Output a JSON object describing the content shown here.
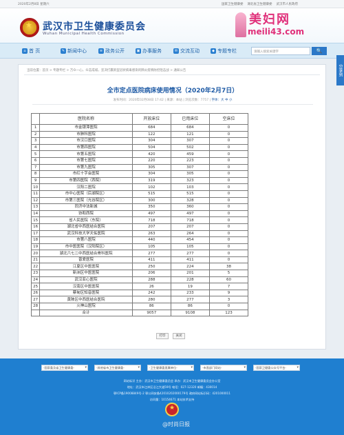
{
  "topbar": {
    "date": "2020年2月8日 星期六",
    "links": [
      "国家卫生健康委",
      "湖北省卫生健康委",
      "武汉市人民政府"
    ]
  },
  "header": {
    "title": "武汉市卫生健康委员会",
    "subtitle": "Wuhan Municipal Health Commission"
  },
  "watermark": {
    "brand": "美妇网",
    "url": "meili43.com"
  },
  "nav": {
    "items": [
      {
        "label": "首 页",
        "icon": "home-icon"
      },
      {
        "label": "新闻中心",
        "icon": "news-icon"
      },
      {
        "label": "政务公开",
        "icon": "document-icon"
      },
      {
        "label": "办事服务",
        "icon": "service-icon"
      },
      {
        "label": "交流互动",
        "icon": "chat-icon"
      },
      {
        "label": "专题专栏",
        "icon": "topic-icon"
      }
    ],
    "search_placeholder": "请输入搜索关键字",
    "search_button": "🔍"
  },
  "side_tab": "分享到",
  "breadcrumb": "当前位置：首页 > 专题专栏 > 万众一心，众志成城，坚决打赢新型冠状病毒感染的肺炎疫情防控阻击战 > 通知公告",
  "article": {
    "title": "全市定点医院病床使用情况（2020年2月7日）",
    "meta_prefix": "发布时间：2020年02月08日 17:42 | 来源：本站 | 浏览次数：",
    "meta_views": "7757",
    "meta_font": "字体：大 中 小"
  },
  "table": {
    "headers": [
      "医院名称",
      "开放床位",
      "已用床位",
      "空床位"
    ],
    "rows": [
      {
        "no": "1",
        "name": "市金银潭医院",
        "open": "684",
        "used": "684",
        "empty": "0"
      },
      {
        "no": "2",
        "name": "市肺科医院",
        "open": "122",
        "used": "121",
        "empty": "0"
      },
      {
        "no": "3",
        "name": "市汉口医院",
        "open": "304",
        "used": "307",
        "empty": "0"
      },
      {
        "no": "4",
        "name": "市第四医院",
        "open": "504",
        "used": "502",
        "empty": "0"
      },
      {
        "no": "5",
        "name": "市第五医院",
        "open": "420",
        "used": "459",
        "empty": "0"
      },
      {
        "no": "6",
        "name": "市第七医院",
        "open": "220",
        "used": "223",
        "empty": "0"
      },
      {
        "no": "7",
        "name": "市第九医院",
        "open": "305",
        "used": "307",
        "empty": "0"
      },
      {
        "no": "8",
        "name": "市红十字会医院",
        "open": "304",
        "used": "305",
        "empty": "0"
      },
      {
        "no": "9",
        "name": "市第四医院（西院）",
        "open": "319",
        "used": "323",
        "empty": "0"
      },
      {
        "no": "10",
        "name": "汉阳二医院",
        "open": "102",
        "used": "103",
        "empty": "0"
      },
      {
        "no": "11",
        "name": "市中心医院（后湖院区）",
        "open": "515",
        "used": "515",
        "empty": "0"
      },
      {
        "no": "12",
        "name": "市第三医院（光谷院区）",
        "open": "300",
        "used": "328",
        "empty": "0"
      },
      {
        "no": "13",
        "name": "同济中法新城",
        "open": "350",
        "used": "360",
        "empty": "0"
      },
      {
        "no": "14",
        "name": "协和西院",
        "open": "497",
        "used": "497",
        "empty": "0"
      },
      {
        "no": "15",
        "name": "省人民医院（东院）",
        "open": "718",
        "used": "718",
        "empty": "0"
      },
      {
        "no": "16",
        "name": "湖北省中西医结合医院",
        "open": "207",
        "used": "207",
        "empty": "0"
      },
      {
        "no": "17",
        "name": "武汉科技大学天佑医院",
        "open": "263",
        "used": "264",
        "empty": "0"
      },
      {
        "no": "18",
        "name": "市第八医院",
        "open": "440",
        "used": "454",
        "empty": "0"
      },
      {
        "no": "19",
        "name": "市中医医院（汉阳院区）",
        "open": "105",
        "used": "105",
        "empty": "0"
      },
      {
        "no": "20",
        "name": "湖北六七二中西医结合骨科医院",
        "open": "277",
        "used": "277",
        "empty": "0"
      },
      {
        "no": "21",
        "name": "普爱医院",
        "open": "411",
        "used": "411",
        "empty": "0"
      },
      {
        "no": "22",
        "name": "江夏区中医医院",
        "open": "250",
        "used": "224",
        "empty": "38"
      },
      {
        "no": "23",
        "name": "新洲区中医医院",
        "open": "206",
        "used": "201",
        "empty": "5"
      },
      {
        "no": "24",
        "name": "武汉亚心医院",
        "open": "288",
        "used": "228",
        "empty": "60"
      },
      {
        "no": "25",
        "name": "汉南区中医医院",
        "open": "26",
        "used": "19",
        "empty": "7"
      },
      {
        "no": "26",
        "name": "蔡甸区知音医院",
        "open": "242",
        "used": "233",
        "empty": "9"
      },
      {
        "no": "27",
        "name": "黄陂区中西医结合医院",
        "open": "280",
        "used": "277",
        "empty": "3"
      },
      {
        "no": "28",
        "name": "火神山医院",
        "open": "86",
        "used": "86",
        "empty": "0"
      }
    ],
    "total": {
      "label": "合计",
      "open": "9057",
      "used": "9108",
      "empty": "123"
    }
  },
  "buttons": {
    "print": "打印",
    "close": "关闭"
  },
  "footer": {
    "selects": [
      "-国家委及省卫生健康委-",
      "-其他省市卫生健康委-",
      "-卫生健康委直属单位-",
      "-市直部门网站-",
      "-国家卫健委公众号平台-"
    ],
    "lines": [
      "网站标识  主办：武汉市卫生健康委员会  承办：武汉市卫生健康委员会办公室",
      "地址：武汉市江岸区沿江大道59号  电话：027-12320  邮编：430014",
      "鄂ICP备19008849号-2  鄂公网安备42010202000179号  政府网站标识码：4201000011",
      "访问量：10154671  本站技术支持"
    ],
    "watermark": "@时尚日报"
  },
  "colors": {
    "brand_blue": "#1e5aa5",
    "nav_bg": "#d9ebf7",
    "footer_bg": "#1f7fd0",
    "watermark_pink": "#e0307a"
  }
}
